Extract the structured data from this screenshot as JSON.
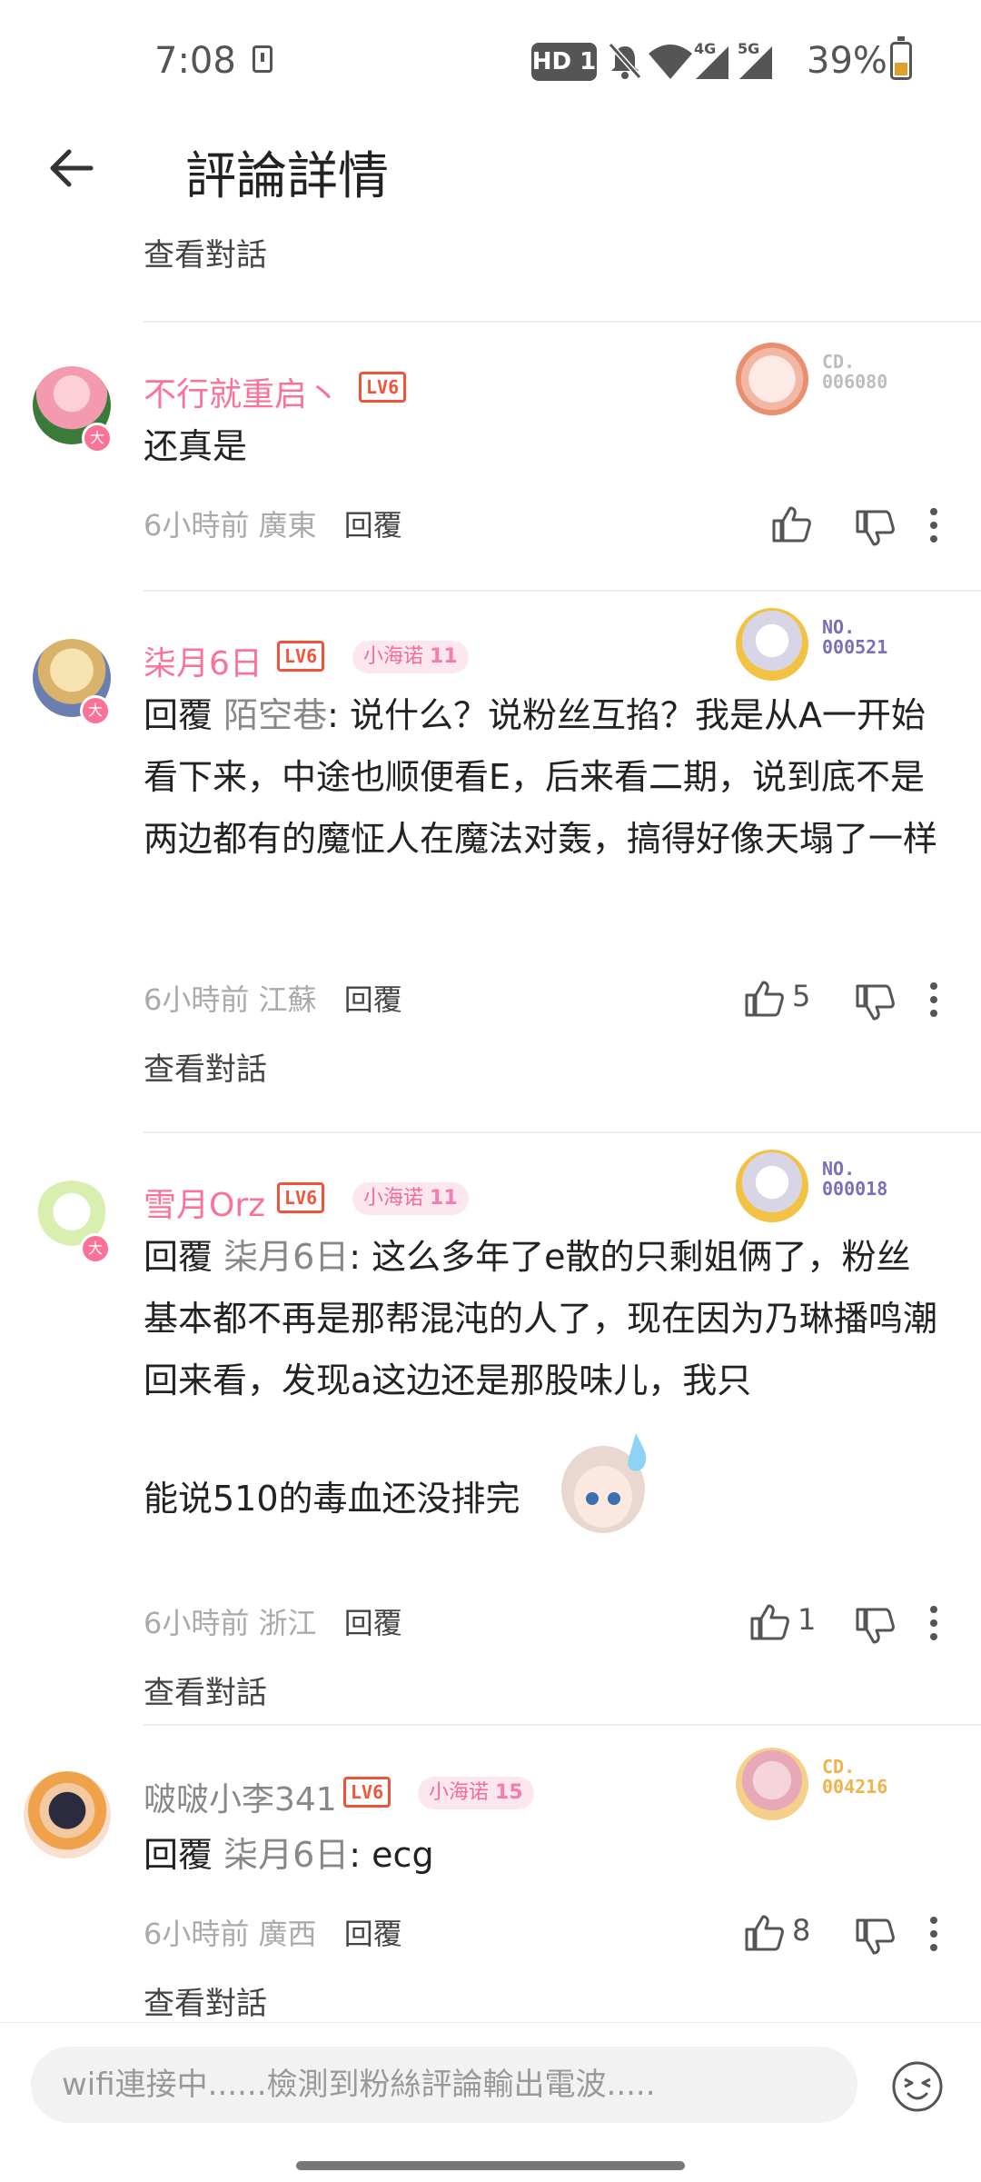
{
  "status_bar": {
    "time": "7:08",
    "hd_badge": "HD 1",
    "network_a": "4G",
    "network_b": "5G",
    "battery": "39%"
  },
  "header": {
    "title": "評論詳情"
  },
  "top_link": "查看對話",
  "comments": [
    {
      "user": "不行就重启丶",
      "level": "LV6",
      "card_no": "CD.\n006080",
      "card_color": "#bdbdbd",
      "text": "还真是",
      "time": "6小時前",
      "location": "廣東",
      "reply_label": "回覆",
      "likes": ""
    },
    {
      "user": "柒月6日",
      "level": "LV6",
      "fan_badge": "小海诺",
      "fan_level": "11",
      "card_no": "NO.\n000521",
      "card_color": "#7b6fb5",
      "reply_prefix": "回覆",
      "reply_to": "陌空巷",
      "text": ": 说什么？说粉丝互掐？我是从A一开始看下来，中途也顺便看E，后来看二期，说到底不是两边都有的魔怔人在魔法对轰，搞得好像天塌了一样",
      "time": "6小時前",
      "location": "江蘇",
      "reply_label": "回覆",
      "likes": "5",
      "view_link": "查看對話"
    },
    {
      "user": "雪月Orz",
      "level": "LV6",
      "fan_badge": "小海诺",
      "fan_level": "11",
      "card_no": "NO.\n000018",
      "card_color": "#7b6fb5",
      "reply_prefix": "回覆",
      "reply_to": "柒月6日",
      "text": ": 这么多年了e散的只剩姐俩了，粉丝基本都不再是那帮混沌的人了，现在因为乃琳播鸣潮回来看，发现a这边还是那股味儿，我只",
      "text2": "能说510的毒血还没排完",
      "time": "6小時前",
      "location": "浙江",
      "reply_label": "回覆",
      "likes": "1",
      "view_link": "查看對話"
    },
    {
      "user": "啵啵小李341",
      "level": "LV6",
      "fan_badge": "小海诺",
      "fan_level": "15",
      "card_no": "CD.\n004216",
      "card_color": "#f0b24a",
      "reply_prefix": "回覆",
      "reply_to": "柒月6日",
      "text": ": ecg",
      "time": "6小時前",
      "location": "廣西",
      "reply_label": "回覆",
      "likes": "8",
      "view_link": "查看對話"
    }
  ],
  "input": {
    "placeholder": "wifi連接中......檢測到粉絲評論輸出電波....."
  },
  "icons": {
    "back": "arrow-left-icon",
    "like": "thumb-up-icon",
    "dislike": "thumb-down-icon",
    "more": "more-vertical-icon",
    "emoji": "emoji-icon"
  }
}
